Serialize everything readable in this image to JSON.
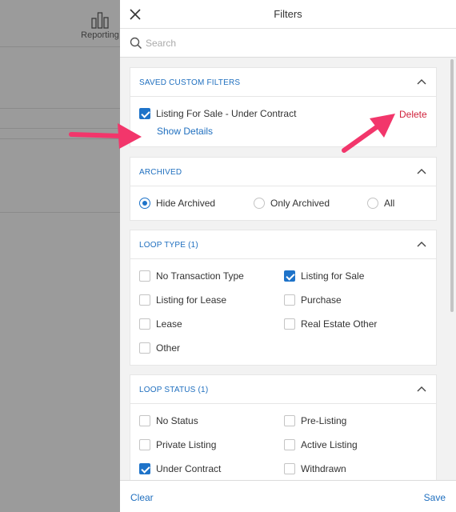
{
  "background": {
    "reporting_label": "Reporting",
    "reporting_icon": "bar-chart-icon"
  },
  "panel": {
    "title": "Filters",
    "close_icon": "close-icon",
    "search": {
      "placeholder": "Search",
      "value": ""
    }
  },
  "sections": {
    "saved": {
      "title": "SAVED CUSTOM FILTERS",
      "filter_label": "Listing For Sale - Under Contract",
      "filter_checked": true,
      "show_details": "Show Details",
      "delete": "Delete"
    },
    "archived": {
      "title": "ARCHIVED",
      "options": [
        {
          "label": "Hide Archived",
          "selected": true
        },
        {
          "label": "Only Archived",
          "selected": false
        },
        {
          "label": "All",
          "selected": false
        }
      ]
    },
    "loop_type": {
      "title": "LOOP TYPE (1)",
      "options": [
        {
          "label": "No Transaction Type",
          "checked": false
        },
        {
          "label": "Listing for Sale",
          "checked": true
        },
        {
          "label": "Listing for Lease",
          "checked": false
        },
        {
          "label": "Purchase",
          "checked": false
        },
        {
          "label": "Lease",
          "checked": false
        },
        {
          "label": "Real Estate Other",
          "checked": false
        },
        {
          "label": "Other",
          "checked": false
        }
      ]
    },
    "loop_status": {
      "title": "LOOP STATUS (1)",
      "options": [
        {
          "label": "No Status",
          "checked": false
        },
        {
          "label": "Pre-Listing",
          "checked": false
        },
        {
          "label": "Private Listing",
          "checked": false
        },
        {
          "label": "Active Listing",
          "checked": false
        },
        {
          "label": "Under Contract",
          "checked": true
        },
        {
          "label": "Withdrawn",
          "checked": false
        }
      ]
    }
  },
  "footer": {
    "clear": "Clear",
    "save": "Save"
  },
  "colors": {
    "accent": "#1e73c9",
    "delete": "#d0213b",
    "annotation_arrow": "#f2366b"
  }
}
